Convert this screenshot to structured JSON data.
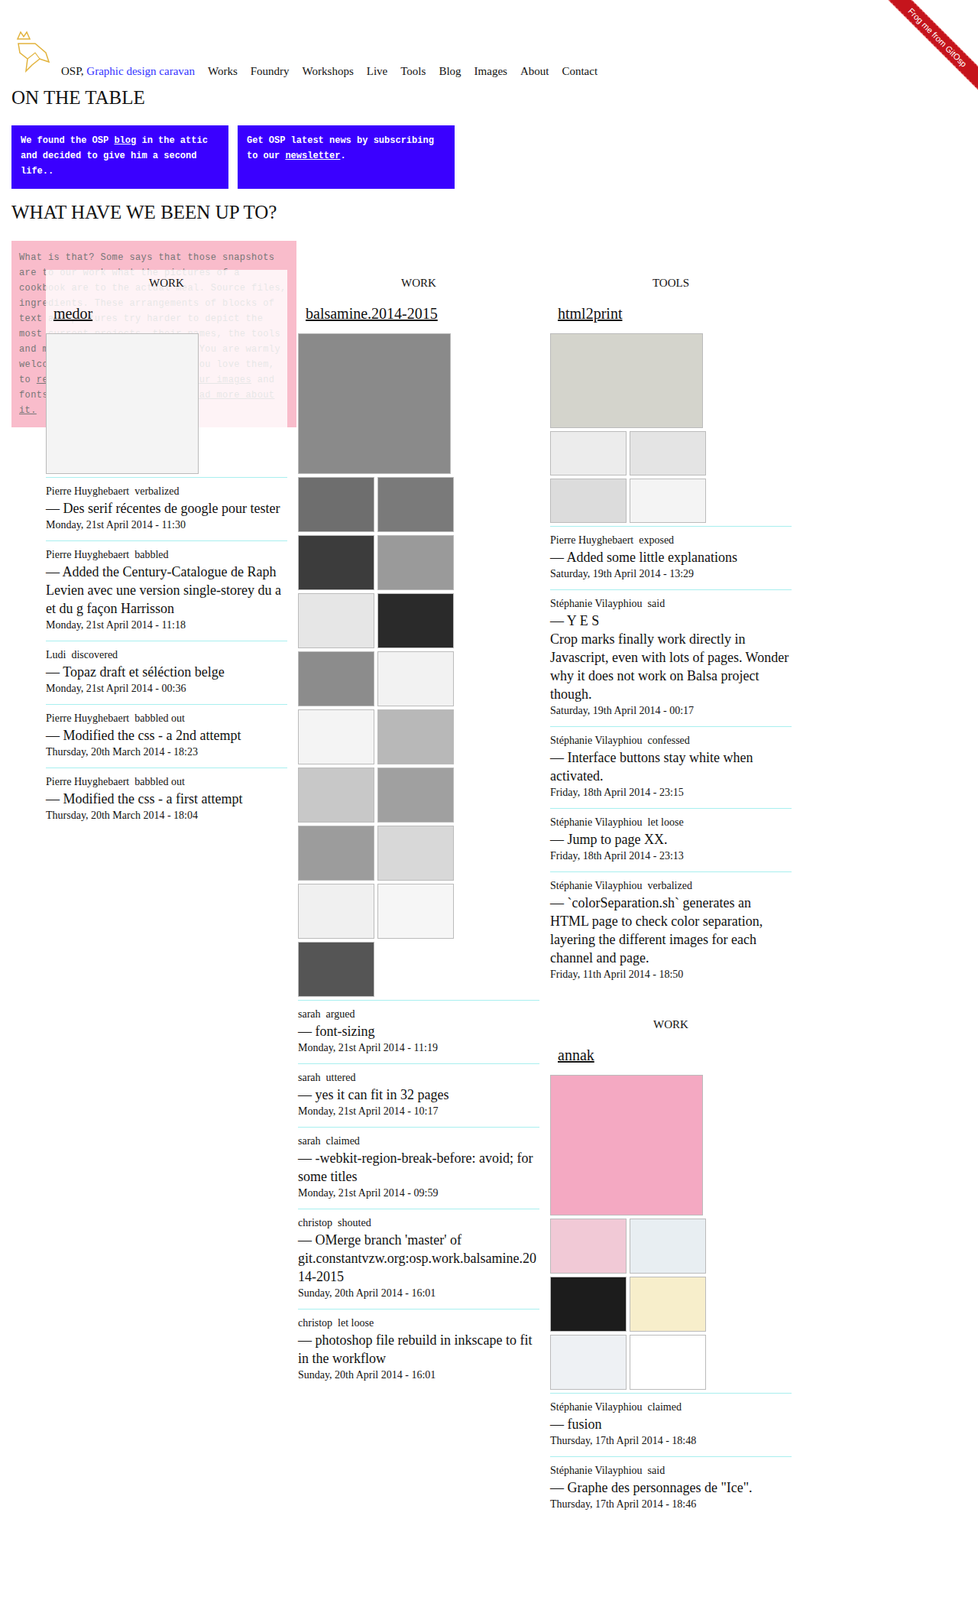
{
  "ribbon": "Frog me from GitOsp",
  "header": {
    "brand": "OSP,",
    "tagline": "Graphic design caravan",
    "nav": [
      "Works",
      "Foundry",
      "Workshops",
      "Live",
      "Tools",
      "Blog",
      "Images",
      "About",
      "Contact"
    ]
  },
  "on_table": {
    "heading": "ON THE TABLE",
    "boxes": [
      {
        "segments": [
          {
            "text": "We found the OSP ",
            "kind": "text"
          },
          {
            "text": "blog",
            "kind": "link"
          },
          {
            "text": " in the attic and decided to give him a second life..",
            "kind": "text"
          }
        ]
      },
      {
        "segments": [
          {
            "text": "Get OSP latest news by subscribing to our ",
            "kind": "text"
          },
          {
            "text": "newsletter",
            "kind": "link"
          },
          {
            "text": ".",
            "kind": "text"
          }
        ]
      }
    ]
  },
  "activity": {
    "heading": "WHAT HAVE WE BEEN UP TO?",
    "intro": [
      {
        "text": "What is that? Some says that those snapshots are to our work what the pictures of a cookbook are to the actual meal. Source files, ingredients. These arrangements of blocks of text and pictures try harder to depict the most current projects, their names, the tools and materials and the sources. You are warmly welcome, and we'd be happy if you love them, to ",
        "kind": "text"
      },
      {
        "text": "reuse, modify and release your images",
        "kind": "link"
      },
      {
        "text": " and fonts to others as you like. ",
        "kind": "text"
      },
      {
        "text": "Read more about it.",
        "kind": "link"
      }
    ],
    "columns": [
      {
        "sections": [
          {
            "label": "WORK",
            "title": "medor",
            "thumbnails": [
              {
                "kind": "big",
                "color": "#f4f4f4"
              }
            ],
            "entries": [
              {
                "author": "Pierre Huyghebaert",
                "verb": "verbalized",
                "message": "— Des serif récentes de google pour tester",
                "date": "Monday, 21st April 2014 - 11:30"
              },
              {
                "author": "Pierre Huyghebaert",
                "verb": "babbled",
                "message": "— Added the Century-Catalogue de Raph Levien avec une version single-storey du a et du g façon Harrisson",
                "date": "Monday, 21st April 2014 - 11:18"
              },
              {
                "author": "Ludi",
                "verb": "discovered",
                "message": "— Topaz draft et séléction belge",
                "date": "Monday, 21st April 2014 - 00:36"
              },
              {
                "author": "Pierre Huyghebaert",
                "verb": "babbled out",
                "message": "— Modified the css - a 2nd attempt",
                "date": "Thursday, 20th March 2014 - 18:23"
              },
              {
                "author": "Pierre Huyghebaert",
                "verb": "babbled out",
                "message": "— Modified the css - a first attempt",
                "date": "Thursday, 20th March 2014 - 18:04"
              }
            ]
          }
        ]
      },
      {
        "sections": [
          {
            "label": "WORK",
            "title": "balsamine.2014-2015",
            "thumbnails": [
              {
                "kind": "big",
                "color": "#8a8a8a"
              },
              {
                "kind": "thumb",
                "color": "#6e6e6e"
              },
              {
                "kind": "thumb",
                "color": "#7a7a7a"
              },
              {
                "kind": "thumb",
                "color": "#3c3c3c"
              },
              {
                "kind": "thumb",
                "color": "#9a9a9a"
              },
              {
                "kind": "thumb",
                "color": "#e6e6e6"
              },
              {
                "kind": "thumb",
                "color": "#2a2a2a"
              },
              {
                "kind": "thumb",
                "color": "#8c8c8c"
              },
              {
                "kind": "thumb",
                "color": "#f2f2f2"
              },
              {
                "kind": "thumb",
                "color": "#f4f4f4"
              },
              {
                "kind": "thumb",
                "color": "#b8b8b8"
              },
              {
                "kind": "thumb",
                "color": "#c8c8c8"
              },
              {
                "kind": "thumb",
                "color": "#a0a0a0"
              },
              {
                "kind": "thumb",
                "color": "#9c9c9c"
              },
              {
                "kind": "thumb",
                "color": "#d8d8d8"
              },
              {
                "kind": "thumb",
                "color": "#f0f0f0"
              },
              {
                "kind": "thumb",
                "color": "#f6f6f6"
              },
              {
                "kind": "thumb",
                "color": "#555555"
              }
            ],
            "entries": [
              {
                "author": "sarah",
                "verb": "argued",
                "message": "— font-sizing",
                "date": "Monday, 21st April 2014 - 11:19"
              },
              {
                "author": "sarah",
                "verb": "uttered",
                "message": "— yes it can fit in 32 pages",
                "date": "Monday, 21st April 2014 - 10:17"
              },
              {
                "author": "sarah",
                "verb": "claimed",
                "message": "— -webkit-region-break-before: avoid; for some titles",
                "date": "Monday, 21st April 2014 - 09:59"
              },
              {
                "author": "christop",
                "verb": "shouted",
                "message": "— OMerge branch 'master' of git.constantvzw.org:osp.work.balsamine.2014-2015",
                "date": "Sunday, 20th April 2014 - 16:01"
              },
              {
                "author": "christop",
                "verb": "let loose",
                "message": "— photoshop file rebuild in inkscape to fit in the workflow",
                "date": "Sunday, 20th April 2014 - 16:01"
              }
            ]
          }
        ]
      },
      {
        "sections": [
          {
            "label": "TOOLS",
            "title": "html2print",
            "thumbnails": [
              {
                "kind": "wide",
                "color": "#d4d4cc"
              },
              {
                "kind": "small",
                "color": "#ececec"
              },
              {
                "kind": "small",
                "color": "#e4e4e4"
              },
              {
                "kind": "small",
                "color": "#dcdcdc"
              },
              {
                "kind": "small",
                "color": "#f4f4f4"
              }
            ],
            "entries": [
              {
                "author": "Pierre Huyghebaert",
                "verb": "exposed",
                "message": "— Added some little explanations",
                "date": "Saturday, 19th April 2014 - 13:29"
              },
              {
                "author": "Stéphanie Vilayphiou",
                "verb": "said",
                "message": "— Y E S\nCrop marks finally work directly in Javascript, even with lots of pages. Wonder why it does not work on Balsa project though.",
                "date": "Saturday, 19th April 2014 - 00:17"
              },
              {
                "author": "Stéphanie Vilayphiou",
                "verb": "confessed",
                "message": "— Interface buttons stay white when activated.",
                "date": "Friday, 18th April 2014 - 23:15"
              },
              {
                "author": "Stéphanie Vilayphiou",
                "verb": "let loose",
                "message": "— Jump to page XX.",
                "date": "Friday, 18th April 2014 - 23:13"
              },
              {
                "author": "Stéphanie Vilayphiou",
                "verb": "verbalized",
                "message": "— `colorSeparation.sh` generates an HTML page to check color separation,\nlayering the different images for each channel and page.",
                "date": "Friday, 11th April 2014 - 18:50"
              }
            ]
          },
          {
            "label": "WORK",
            "title": "annak",
            "thumbnails": [
              {
                "kind": "big",
                "color": "#f4a9c2"
              },
              {
                "kind": "thumb",
                "color": "#f1c9d6"
              },
              {
                "kind": "thumb",
                "color": "#e8eef2"
              },
              {
                "kind": "thumb",
                "color": "#1c1c1c"
              },
              {
                "kind": "thumb",
                "color": "#f7eecb"
              },
              {
                "kind": "thumb",
                "color": "#eef1f4"
              },
              {
                "kind": "thumb",
                "color": "#ffffff"
              }
            ],
            "entries": [
              {
                "author": "Stéphanie Vilayphiou",
                "verb": "claimed",
                "message": "— fusion",
                "date": "Thursday, 17th April 2014 - 18:48"
              },
              {
                "author": "Stéphanie Vilayphiou",
                "verb": "said",
                "message": "— Graphe des personnages de \"Ice\".",
                "date": "Thursday, 17th April 2014 - 18:46"
              }
            ]
          }
        ]
      }
    ]
  }
}
